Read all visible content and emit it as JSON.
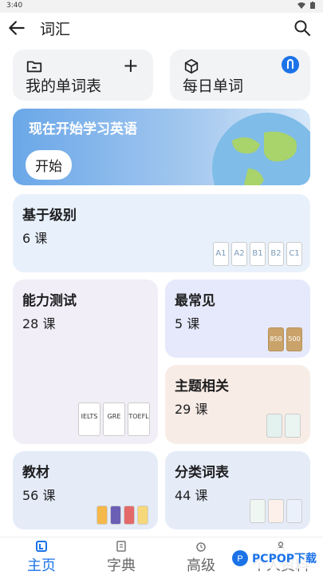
{
  "status": {
    "time": "3:40"
  },
  "appbar": {
    "title": "词汇"
  },
  "quick": {
    "my_words": "我的单词表",
    "daily_words": "每日单词"
  },
  "banner": {
    "title": "现在开始学习英语",
    "start": "开始"
  },
  "tiles": {
    "level": {
      "title": "基于级别",
      "count": "6 课"
    },
    "ability": {
      "title": "能力测试",
      "count": "28 课"
    },
    "common": {
      "title": "最常见",
      "count": "5 课"
    },
    "topic": {
      "title": "主题相关",
      "count": "29 课"
    },
    "textbook": {
      "title": "教材",
      "count": "56 课"
    },
    "category": {
      "title": "分类词表",
      "count": "44 课"
    }
  },
  "level_badges": [
    "A1",
    "A2",
    "B1",
    "B2",
    "C1"
  ],
  "test_books": [
    "IELTS",
    "GRE",
    "TOEFL"
  ],
  "common_books": [
    "850",
    "500"
  ],
  "nav": {
    "home": "主页",
    "dictionary": "字典",
    "advanced": "高级",
    "profile": "个人资料"
  },
  "watermark": "PCPOP下载",
  "colors": {
    "accent": "#1c73e8",
    "tile_blue": "#e8f1fb",
    "tile_lavender": "#f1eef7",
    "tile_indigo": "#e6e9fb",
    "tile_peach": "#f8ece6",
    "tile_blue2": "#e5ecf8"
  }
}
